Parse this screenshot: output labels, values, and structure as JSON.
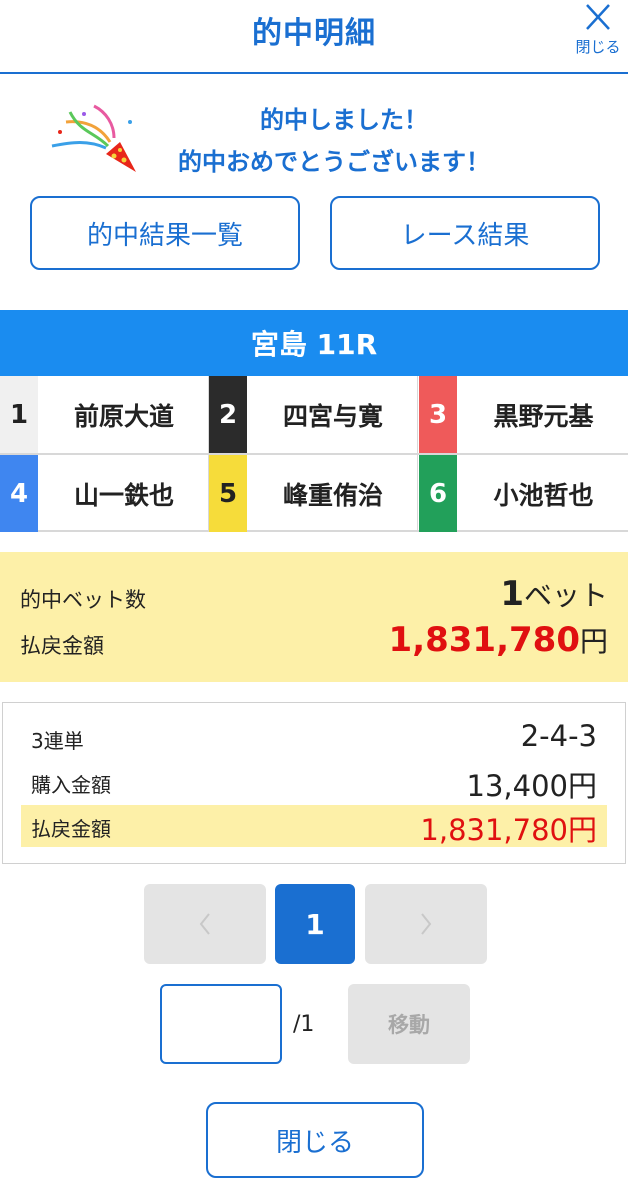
{
  "header": {
    "title": "的中明細",
    "close_label": "閉じる",
    "close_icon": "close-icon",
    "accent_color": "#1a6fd1"
  },
  "congrats": {
    "icon": "party-popper-icon",
    "line1": "的中しました！",
    "line2": "的中おめでとうございます！"
  },
  "actions": {
    "hit_list_label": "的中結果一覧",
    "race_result_label": "レース結果"
  },
  "race": {
    "title": "宮島 11R",
    "bar_color": "#1a8cf0",
    "racers": [
      {
        "no": "1",
        "name": "前原大道",
        "bg": "#f0f0f0",
        "fg": "#222222"
      },
      {
        "no": "2",
        "name": "四宮与寛",
        "bg": "#2b2b2b",
        "fg": "#ffffff"
      },
      {
        "no": "3",
        "name": "黒野元基",
        "bg": "#ef5a5a",
        "fg": "#ffffff"
      },
      {
        "no": "4",
        "name": "山一鉄也",
        "bg": "#3f86f0",
        "fg": "#ffffff"
      },
      {
        "no": "5",
        "name": "峰重侑治",
        "bg": "#f6dc3a",
        "fg": "#222222"
      },
      {
        "no": "6",
        "name": "小池哲也",
        "bg": "#22a05a",
        "fg": "#ffffff"
      }
    ]
  },
  "summary": {
    "bet_count_label": "的中ベット数",
    "bet_count": "1",
    "bet_unit": "ベット",
    "payout_label": "払戻金額",
    "payout": "1,831,780",
    "yen": "円"
  },
  "detail": {
    "type_label": "3連単",
    "combination": "2-4-3",
    "purchase_label": "購入金額",
    "purchase_amount": "13,400円",
    "payout_label": "払戻金額",
    "payout_amount": "1,831,780円"
  },
  "pagination": {
    "current_page": "1",
    "total_pages": "/1",
    "input_value": "",
    "move_label": "移動"
  },
  "footer": {
    "close_label": "閉じる"
  }
}
